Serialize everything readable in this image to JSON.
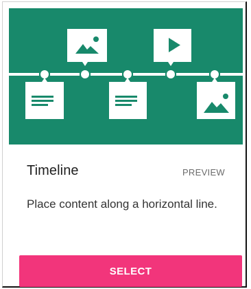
{
  "card": {
    "title": "Timeline",
    "badge": "PREVIEW",
    "description": "Place content along a horizontal line.",
    "action_label": "SELECT"
  },
  "colors": {
    "hero_background": "#18896b",
    "action_background": "#f2357b",
    "action_text": "#ffffff"
  },
  "illustration": {
    "icons": [
      "image-icon",
      "play-icon",
      "text-document-icon",
      "text-document-icon",
      "image-icon"
    ]
  }
}
